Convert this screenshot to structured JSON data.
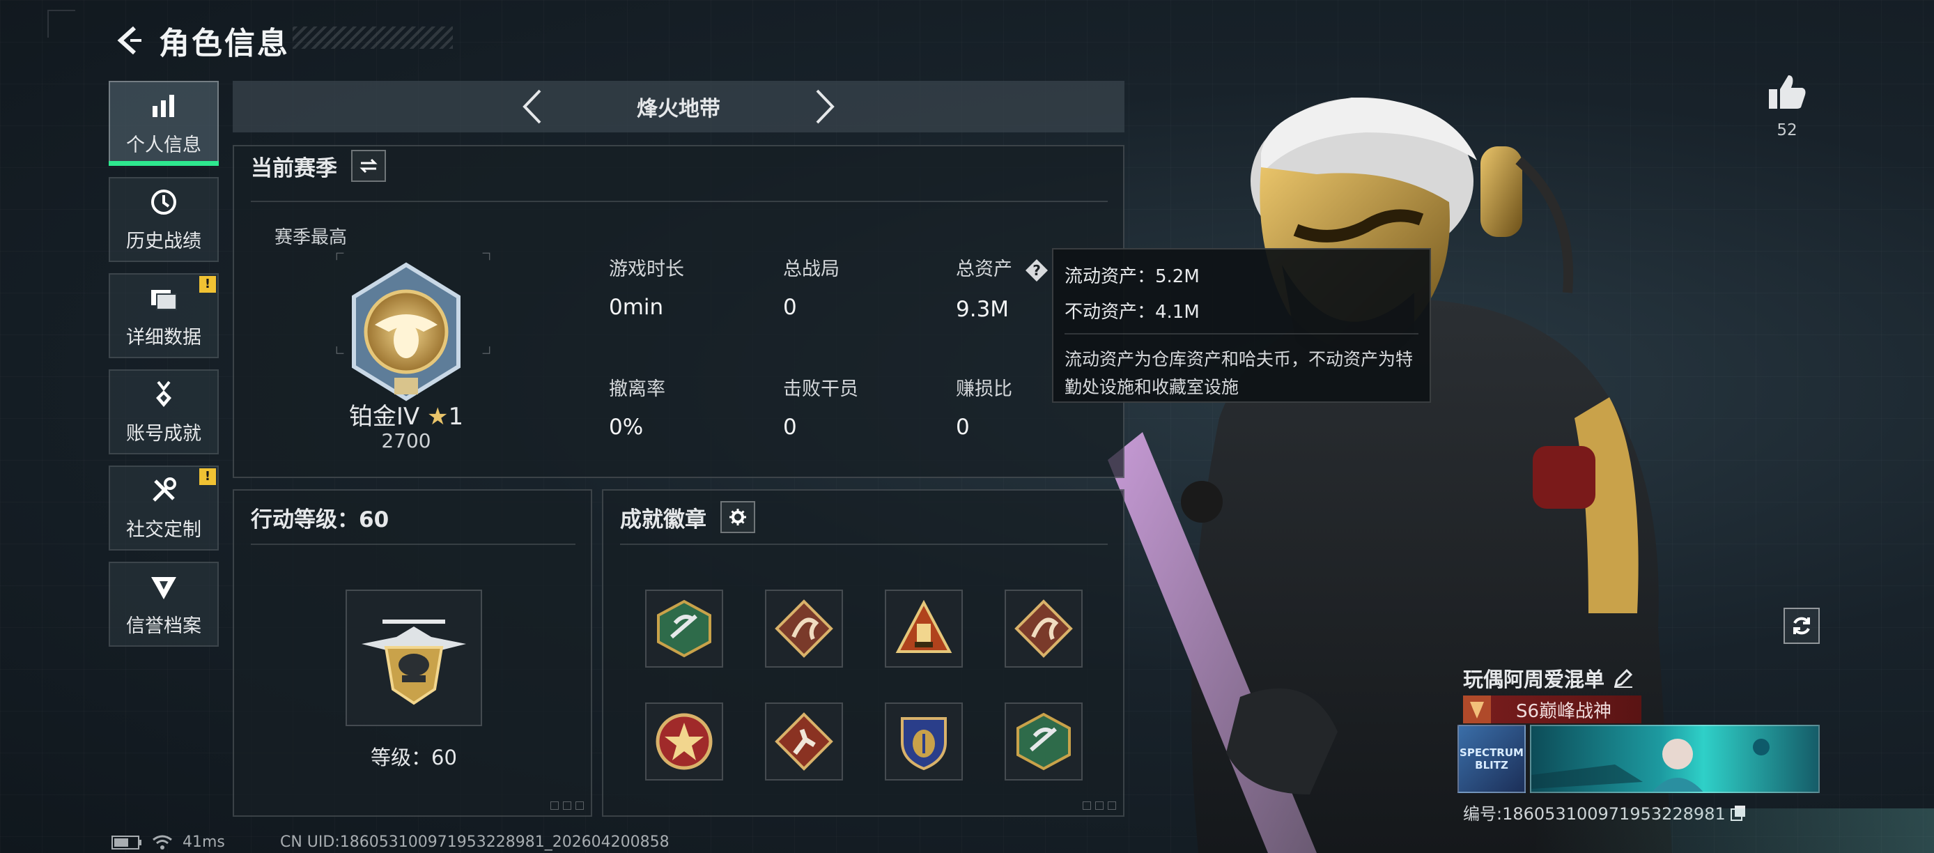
{
  "header": {
    "title": "角色信息"
  },
  "sidebar": {
    "items": [
      {
        "label": "个人信息",
        "active": true,
        "warn": ""
      },
      {
        "label": "历史战绩",
        "active": false,
        "warn": ""
      },
      {
        "label": "详细数据",
        "active": false,
        "warn": "!"
      },
      {
        "label": "账号成就",
        "active": false,
        "warn": ""
      },
      {
        "label": "社交定制",
        "active": false,
        "warn": "!"
      },
      {
        "label": "信誉档案",
        "active": false,
        "warn": ""
      }
    ]
  },
  "mode": {
    "title": "烽火地带"
  },
  "season": {
    "title": "当前赛季",
    "best_label": "赛季最高",
    "rank_name": "铂金IV",
    "rank_stars": "1",
    "rank_score": "2700",
    "stats": [
      {
        "label": "游戏时长",
        "value": "0min"
      },
      {
        "label": "总战局",
        "value": "0"
      },
      {
        "label": "总资产",
        "value": "9.3M"
      },
      {
        "label": "撤离率",
        "value": "0%"
      },
      {
        "label": "击败干员",
        "value": "0"
      },
      {
        "label": "赚损比",
        "value": "0"
      }
    ]
  },
  "tooltip": {
    "line1": "流动资产：5.2M",
    "line2": "不动资产：4.1M",
    "desc": "流动资产为仓库资产和哈夫币，不动资产为特勤处设施和收藏室设施"
  },
  "level": {
    "title": "行动等级：60",
    "text": "等级：60"
  },
  "achievements": {
    "title": "成就徽章",
    "badges": [
      "wasp-badge-icon",
      "dragon-badge-icon",
      "tower-badge-icon",
      "dragon-badge-icon",
      "star-badge-icon",
      "runner-badge-icon",
      "shield-badge-icon",
      "wasp-badge-icon"
    ]
  },
  "like": {
    "count": "52"
  },
  "player": {
    "name": "玩偶阿周爱混单",
    "title_tag": "S6巅峰战神",
    "id_text": "编号:1860531009719532289​81",
    "banner_label": "SPECTRUM BLITZ"
  },
  "status": {
    "ping": "41ms",
    "uid": "CN UID:1860531009719532289​81_202604200858"
  },
  "colors": {
    "accent": "#2ee88f",
    "warn": "#f0c233",
    "gold": "#c9a24a"
  }
}
